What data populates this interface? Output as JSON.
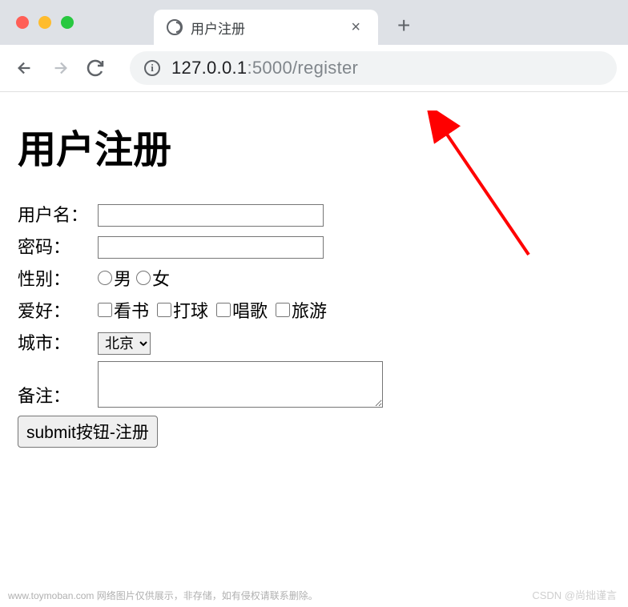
{
  "browser": {
    "tab": {
      "title": "用户注册"
    },
    "url": {
      "host": "127.0.0.1",
      "path": ":5000/register"
    }
  },
  "page": {
    "title": "用户注册"
  },
  "form": {
    "username_label": "用户名：",
    "password_label": "密码：",
    "gender_label": "性别：",
    "gender_options": {
      "male": "男",
      "female": "女"
    },
    "hobby_label": "爱好：",
    "hobby_options": {
      "read": "看书",
      "ball": "打球",
      "sing": "唱歌",
      "travel": "旅游"
    },
    "city_label": "城市：",
    "city_selected": "北京",
    "remark_label": "备注：",
    "submit_label": "submit按钮-注册"
  },
  "watermarks": {
    "left": "www.toymoban.com  网络图片仅供展示，非存储，如有侵权请联系删除。",
    "right": "CSDN @尚拙谨言"
  }
}
